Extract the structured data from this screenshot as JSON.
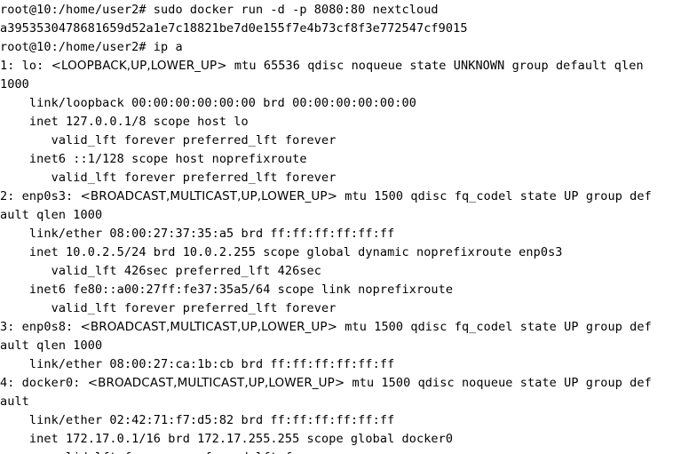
{
  "terminal": {
    "lines": [
      [
        {
          "text": "root@10:/home/user2# sudo docker run -d -p 8080:80 nextcloud",
          "font": "mono"
        }
      ],
      [
        {
          "text": "a3953530478681659d52a1e7c18821be7d0e155f7e4b73cf8f3e772547cf9015",
          "font": "mono"
        }
      ],
      [
        {
          "text": "root@10:/home/user2# ip a",
          "font": "mono"
        }
      ],
      [
        {
          "text": "1: lo: ",
          "font": "mono"
        },
        {
          "text": "<LOOPBACK,UP,LOWER_UP>",
          "font": "sans"
        },
        {
          "text": " mtu 65536 qdisc noqueue state UNKNOWN group default qlen",
          "font": "mono"
        }
      ],
      [
        {
          "text": "1000",
          "font": "mono"
        }
      ],
      [
        {
          "text": "    link/loopback 00:00:00:00:00:00 brd 00:00:00:00:00:00",
          "font": "mono"
        }
      ],
      [
        {
          "text": "    inet 127.0.0.1/8 scope host lo",
          "font": "mono"
        }
      ],
      [
        {
          "text": "       valid_lft forever preferred_lft forever",
          "font": "mono"
        }
      ],
      [
        {
          "text": "    inet6 ::1/128 scope host noprefixroute",
          "font": "mono"
        }
      ],
      [
        {
          "text": "       valid_lft forever preferred_lft forever",
          "font": "mono"
        }
      ],
      [
        {
          "text": "2: enp0s3: ",
          "font": "mono"
        },
        {
          "text": "<BROADCAST,MULTICAST,UP,LOWER_UP>",
          "font": "sans"
        },
        {
          "text": " mtu 1500 qdisc fq_codel state UP group def",
          "font": "mono"
        }
      ],
      [
        {
          "text": "ault qlen 1000",
          "font": "mono"
        }
      ],
      [
        {
          "text": "    link/ether 08:00:27:37:35:a5 brd ff:ff:ff:ff:ff:ff",
          "font": "mono"
        }
      ],
      [
        {
          "text": "    inet 10.0.2.5/24 brd 10.0.2.255 scope global dynamic noprefixroute enp0s3",
          "font": "mono"
        }
      ],
      [
        {
          "text": "       valid_lft 426sec preferred_lft 426sec",
          "font": "mono"
        }
      ],
      [
        {
          "text": "    inet6 fe80::a00:27ff:fe37:35a5/64 scope link noprefixroute",
          "font": "mono"
        }
      ],
      [
        {
          "text": "       valid_lft forever preferred_lft forever",
          "font": "mono"
        }
      ],
      [
        {
          "text": "3: enp0s8: ",
          "font": "mono"
        },
        {
          "text": "<BROADCAST,MULTICAST,UP,LOWER_UP>",
          "font": "sans"
        },
        {
          "text": " mtu 1500 qdisc fq_codel state UP group def",
          "font": "mono"
        }
      ],
      [
        {
          "text": "ault qlen 1000",
          "font": "mono"
        }
      ],
      [
        {
          "text": "    link/ether 08:00:27:ca:1b:cb brd ff:ff:ff:ff:ff:ff",
          "font": "mono"
        }
      ],
      [
        {
          "text": "4: docker0: ",
          "font": "mono"
        },
        {
          "text": "<BROADCAST,MULTICAST,UP,LOWER_UP>",
          "font": "sans"
        },
        {
          "text": " mtu 1500 qdisc noqueue state UP group def",
          "font": "mono"
        }
      ],
      [
        {
          "text": "ault",
          "font": "mono"
        }
      ],
      [
        {
          "text": "    link/ether 02:42:71:f7:d5:82 brd ff:ff:ff:ff:ff:ff",
          "font": "mono"
        }
      ],
      [
        {
          "text": "    inet 172.17.0.1/16 brd 172.17.255.255 scope global docker0",
          "font": "mono"
        }
      ],
      [
        {
          "text": "       valid_lft forever preferred_lft forever",
          "font": "mono"
        }
      ]
    ]
  },
  "colors": {
    "background": "#ffffff",
    "text": "#000000"
  }
}
